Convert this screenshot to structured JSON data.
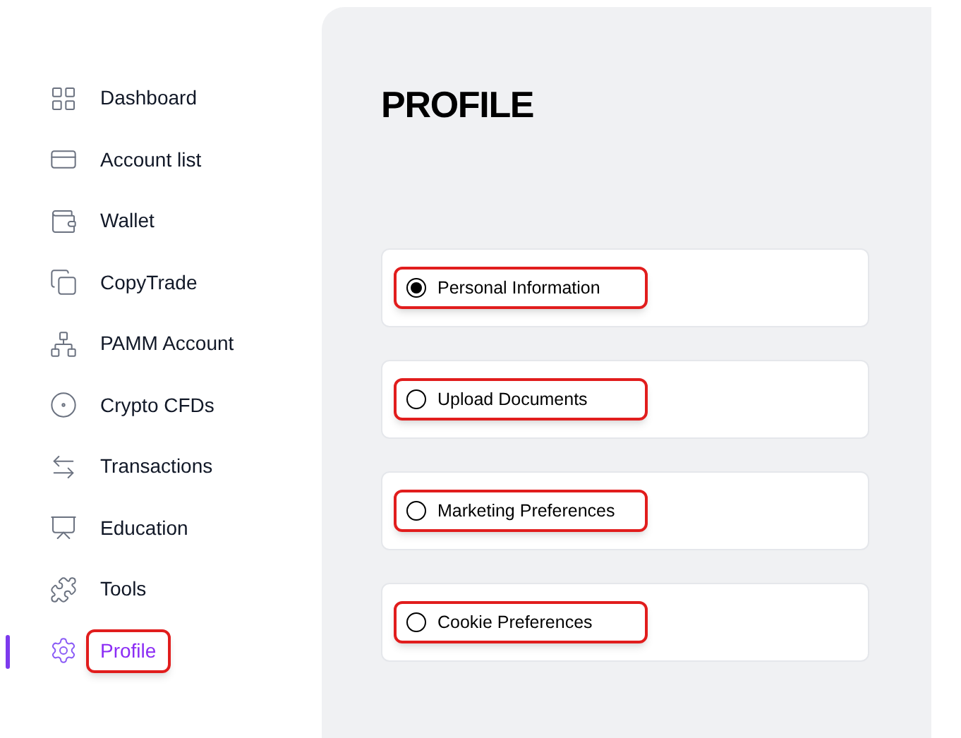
{
  "sidebar": {
    "items": [
      {
        "label": "Dashboard",
        "kind": "dashboard",
        "selected": false,
        "highlighted": false
      },
      {
        "label": "Account list",
        "kind": "accounts",
        "selected": false,
        "highlighted": false
      },
      {
        "label": "Wallet",
        "kind": "wallet",
        "selected": false,
        "highlighted": false
      },
      {
        "label": "CopyTrade",
        "kind": "copytrade",
        "selected": false,
        "highlighted": false
      },
      {
        "label": "PAMM Account",
        "kind": "pamm",
        "selected": false,
        "highlighted": false
      },
      {
        "label": "Crypto CFDs",
        "kind": "crypto",
        "selected": false,
        "highlighted": false
      },
      {
        "label": "Transactions",
        "kind": "transactions",
        "selected": false,
        "highlighted": false
      },
      {
        "label": "Education",
        "kind": "education",
        "selected": false,
        "highlighted": false
      },
      {
        "label": "Tools",
        "kind": "tools",
        "selected": false,
        "highlighted": false
      },
      {
        "label": "Profile",
        "kind": "profile",
        "selected": true,
        "highlighted": true
      }
    ]
  },
  "page": {
    "title": "PROFILE",
    "options": [
      {
        "label": "Personal Information",
        "selected": true,
        "highlighted": true
      },
      {
        "label": "Upload Documents",
        "selected": false,
        "highlighted": true
      },
      {
        "label": "Marketing Preferences",
        "selected": false,
        "highlighted": true
      },
      {
        "label": "Cookie Preferences",
        "selected": false,
        "highlighted": true
      }
    ]
  }
}
